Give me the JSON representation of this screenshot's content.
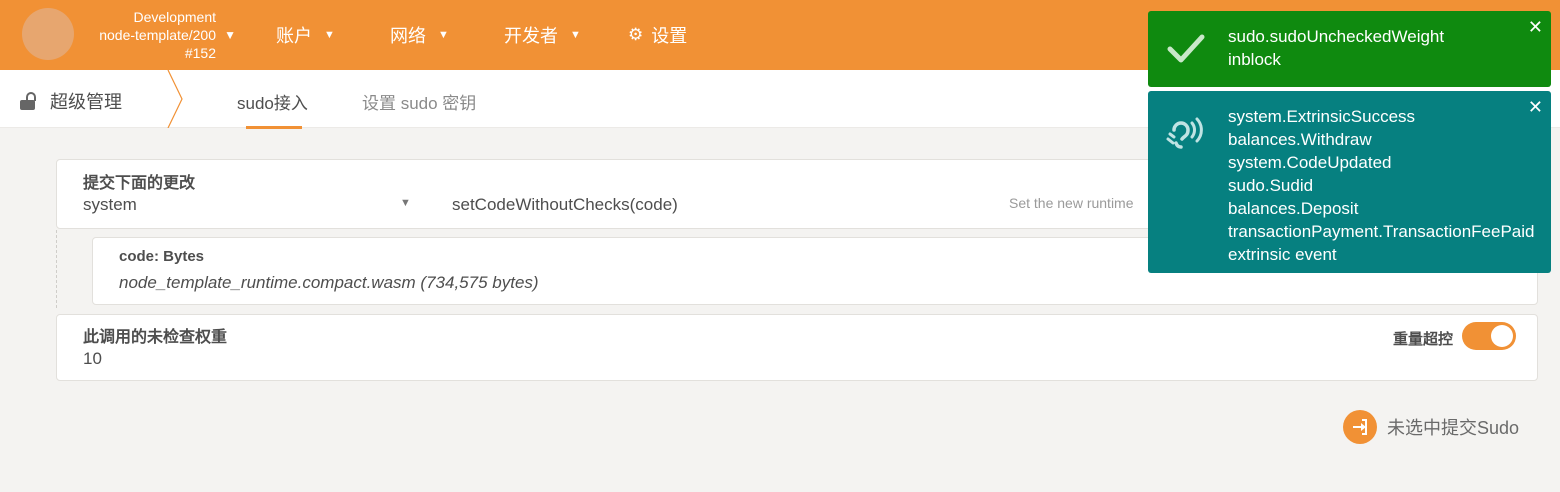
{
  "header": {
    "chain": {
      "line1": "Development",
      "line2": "node-template/200",
      "line3": "#152"
    },
    "nav": [
      {
        "label": "账户",
        "icon": "chevron-down-icon"
      },
      {
        "label": "网络",
        "icon": "chevron-down-icon"
      },
      {
        "label": "开发者",
        "icon": "chevron-down-icon"
      },
      {
        "label": "设置",
        "icon": "gear-icon"
      }
    ]
  },
  "tabs": {
    "section_title": "超级管理",
    "items": [
      "sudo接入",
      "设置 sudo 密钥"
    ],
    "active_index": 0
  },
  "call": {
    "title": "提交下面的更改",
    "module": "system",
    "method": "setCodeWithoutChecks(code)",
    "method_hint": "Set the new runtime"
  },
  "param": {
    "label": "code: Bytes",
    "value": "node_template_runtime.compact.wasm (734,575 bytes)"
  },
  "weight": {
    "label": "此调用的未检查权重",
    "value": "10",
    "override_label": "重量超控",
    "override_on": true
  },
  "submit": {
    "label": "未选中提交Sudo"
  },
  "toasts": [
    {
      "type": "success",
      "color": "#0f8a0f",
      "lines": [
        "sudo.sudoUncheckedWeight"
      ],
      "status": "inblock"
    },
    {
      "type": "events",
      "color": "#068080",
      "lines": [
        "system.ExtrinsicSuccess",
        "balances.Withdraw",
        "system.CodeUpdated",
        "sudo.Sudid",
        "balances.Deposit",
        "transactionPayment.TransactionFeePaid"
      ],
      "status": "extrinsic event"
    }
  ],
  "colors": {
    "brand": "#f19135",
    "success": "#0f8a0f",
    "info": "#068080"
  }
}
